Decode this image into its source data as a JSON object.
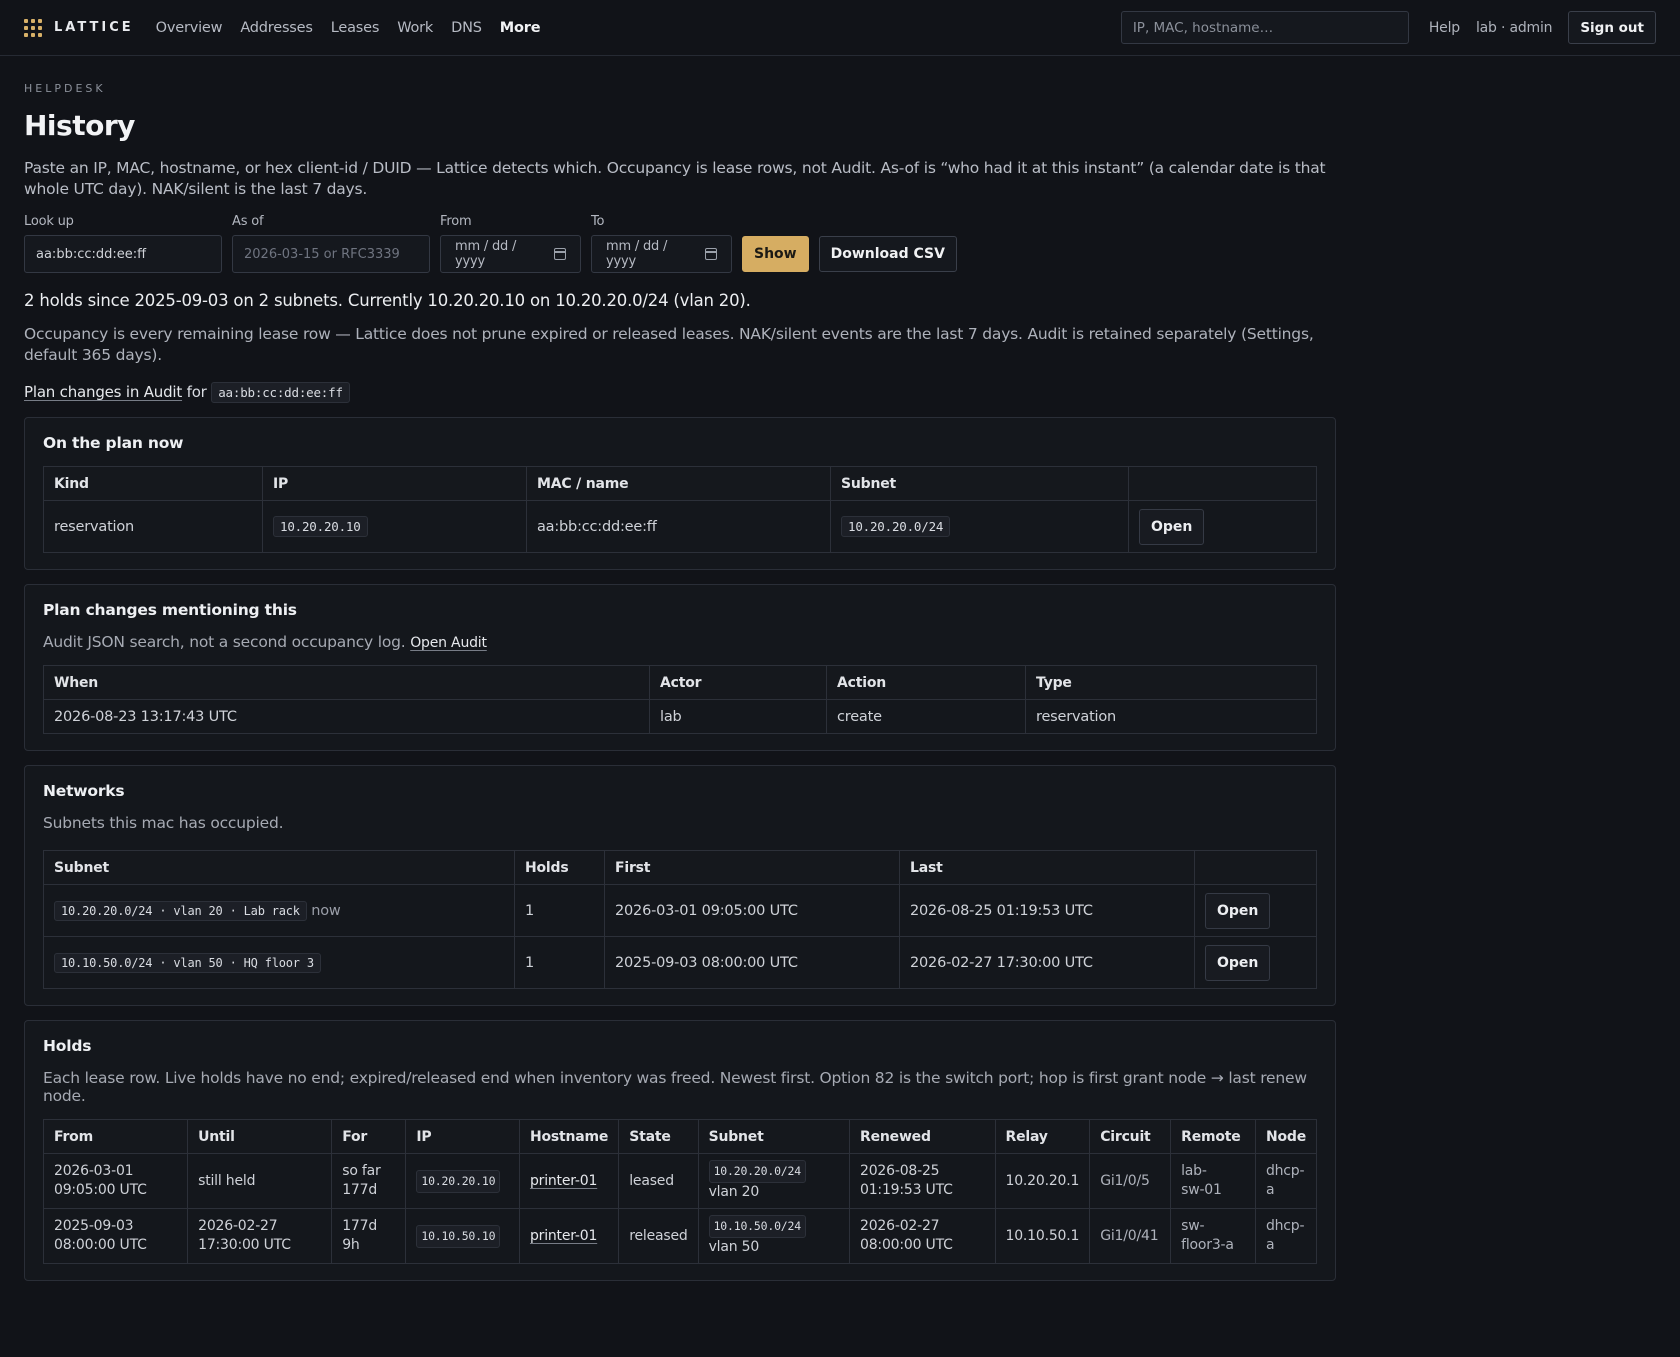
{
  "brand": {
    "name": "LATTICE"
  },
  "nav": [
    "Overview",
    "Addresses",
    "Leases",
    "Work",
    "DNS",
    "More"
  ],
  "topbar": {
    "search_placeholder": "IP, MAC, hostname…",
    "help": "Help",
    "user": "lab · admin",
    "sign_out": "Sign out"
  },
  "page": {
    "eyebrow": "HELPDESK",
    "title": "History",
    "lead": "Paste an IP, MAC, hostname, or hex client-id / DUID — Lattice detects which. Occupancy is lease rows, not Audit. As-of is “who had it at this instant” (a calendar date is that whole UTC day). NAK/silent is the last 7 days."
  },
  "form": {
    "lookup_label": "Look up",
    "lookup_value": "aa:bb:cc:dd:ee:ff",
    "asof_label": "As of",
    "asof_placeholder": "2026-03-15 or RFC3339",
    "from_label": "From",
    "from_placeholder": "mm / dd / yyyy",
    "to_label": "To",
    "to_placeholder": "mm / dd / yyyy",
    "show": "Show",
    "csv": "Download CSV"
  },
  "summary": "2 holds since 2025-09-03 on 2 subnets. Currently 10.20.20.10 on 10.20.20.0/24 (vlan 20).",
  "note": "Occupancy is every remaining lease row — Lattice does not prune expired or released leases. NAK/silent events are the last 7 days. Audit is retained separately (Settings, default 365 days).",
  "plan_link": {
    "link": "Plan changes in Audit",
    "for": "for",
    "mac": "aa:bb:cc:dd:ee:ff"
  },
  "plan_now": {
    "title": "On the plan now",
    "headers": [
      "Kind",
      "IP",
      "MAC / name",
      "Subnet",
      ""
    ],
    "row": {
      "kind": "reservation",
      "ip": "10.20.20.10",
      "mac": "aa:bb:cc:dd:ee:ff",
      "subnet": "10.20.20.0/24",
      "action": "Open"
    }
  },
  "plan_changes": {
    "title": "Plan changes mentioning this",
    "sub": "Audit JSON search, not a second occupancy log.",
    "sub_link": "Open Audit",
    "headers": [
      "When",
      "Actor",
      "Action",
      "Type"
    ],
    "row": {
      "when": "2026-08-23 13:17:43 UTC",
      "actor": "lab",
      "action": "create",
      "type": "reservation"
    }
  },
  "networks": {
    "title": "Networks",
    "sub": "Subnets this mac has occupied.",
    "headers": [
      "Subnet",
      "Holds",
      "First",
      "Last",
      ""
    ],
    "rows": [
      {
        "subnet": "10.20.20.0/24 · vlan 20 · Lab rack",
        "tag": "now",
        "holds": "1",
        "first": "2026-03-01 09:05:00 UTC",
        "last": "2026-08-25 01:19:53 UTC",
        "action": "Open"
      },
      {
        "subnet": "10.10.50.0/24 · vlan 50 · HQ floor 3",
        "tag": "",
        "holds": "1",
        "first": "2025-09-03 08:00:00 UTC",
        "last": "2026-02-27 17:30:00 UTC",
        "action": "Open"
      }
    ]
  },
  "holds": {
    "title": "Holds",
    "sub": "Each lease row. Live holds have no end; expired/released end when inventory was freed. Newest first. Option 82 is the switch port; hop is first grant node → last renew node.",
    "headers": [
      "From",
      "Until",
      "For",
      "IP",
      "Hostname",
      "State",
      "Subnet",
      "Renewed",
      "Relay",
      "Circuit",
      "Remote",
      "Node"
    ],
    "rows": [
      {
        "from1": "2026-03-01",
        "from2": "09:05:00 UTC",
        "until1": "still held",
        "until2": "",
        "for1": "so far",
        "for2": "177d",
        "ip": "10.20.20.10",
        "hostname": "printer-01",
        "state": "leased",
        "subnet": "10.20.20.0/24",
        "vlan": "vlan 20",
        "ren1": "2026-08-25",
        "ren2": "01:19:53 UTC",
        "relay": "10.20.20.1",
        "circuit": "Gi1/0/5",
        "remote1": "lab-",
        "remote2": "sw-01",
        "node1": "dhcp-",
        "node2": "a"
      },
      {
        "from1": "2025-09-03",
        "from2": "08:00:00 UTC",
        "until1": "2026-02-27",
        "until2": "17:30:00 UTC",
        "for1": "177d",
        "for2": "9h",
        "ip": "10.10.50.10",
        "hostname": "printer-01",
        "state": "released",
        "subnet": "10.10.50.0/24",
        "vlan": "vlan 50",
        "ren1": "2026-02-27",
        "ren2": "08:00:00 UTC",
        "relay": "10.10.50.1",
        "circuit": "Gi1/0/41",
        "remote1": "sw-",
        "remote2": "floor3-a",
        "node1": "dhcp-",
        "node2": "a"
      }
    ]
  }
}
